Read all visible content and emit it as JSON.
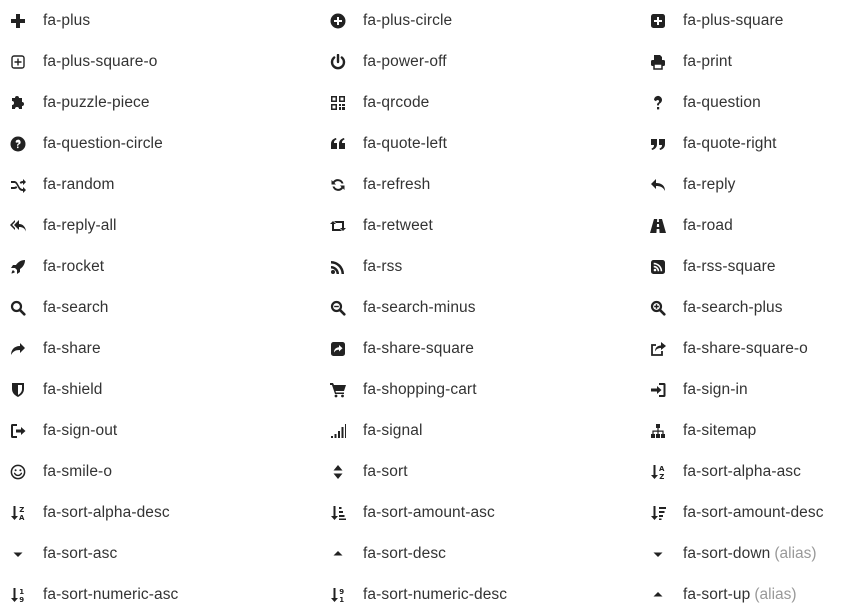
{
  "alias_text": "(alias)",
  "items": [
    {
      "label": "fa-plus",
      "icon": "plus-icon",
      "alias": false
    },
    {
      "label": "fa-plus-circle",
      "icon": "plus-circle-icon",
      "alias": false
    },
    {
      "label": "fa-plus-square",
      "icon": "plus-square-icon",
      "alias": false
    },
    {
      "label": "fa-plus-square-o",
      "icon": "plus-square-o-icon",
      "alias": false
    },
    {
      "label": "fa-power-off",
      "icon": "power-off-icon",
      "alias": false
    },
    {
      "label": "fa-print",
      "icon": "print-icon",
      "alias": false
    },
    {
      "label": "fa-puzzle-piece",
      "icon": "puzzle-piece-icon",
      "alias": false
    },
    {
      "label": "fa-qrcode",
      "icon": "qrcode-icon",
      "alias": false
    },
    {
      "label": "fa-question",
      "icon": "question-icon",
      "alias": false
    },
    {
      "label": "fa-question-circle",
      "icon": "question-circle-icon",
      "alias": false
    },
    {
      "label": "fa-quote-left",
      "icon": "quote-left-icon",
      "alias": false
    },
    {
      "label": "fa-quote-right",
      "icon": "quote-right-icon",
      "alias": false
    },
    {
      "label": "fa-random",
      "icon": "random-icon",
      "alias": false
    },
    {
      "label": "fa-refresh",
      "icon": "refresh-icon",
      "alias": false
    },
    {
      "label": "fa-reply",
      "icon": "reply-icon",
      "alias": false
    },
    {
      "label": "fa-reply-all",
      "icon": "reply-all-icon",
      "alias": false
    },
    {
      "label": "fa-retweet",
      "icon": "retweet-icon",
      "alias": false
    },
    {
      "label": "fa-road",
      "icon": "road-icon",
      "alias": false
    },
    {
      "label": "fa-rocket",
      "icon": "rocket-icon",
      "alias": false
    },
    {
      "label": "fa-rss",
      "icon": "rss-icon",
      "alias": false
    },
    {
      "label": "fa-rss-square",
      "icon": "rss-square-icon",
      "alias": false
    },
    {
      "label": "fa-search",
      "icon": "search-icon",
      "alias": false
    },
    {
      "label": "fa-search-minus",
      "icon": "search-minus-icon",
      "alias": false
    },
    {
      "label": "fa-search-plus",
      "icon": "search-plus-icon",
      "alias": false
    },
    {
      "label": "fa-share",
      "icon": "share-icon",
      "alias": false
    },
    {
      "label": "fa-share-square",
      "icon": "share-square-icon",
      "alias": false
    },
    {
      "label": "fa-share-square-o",
      "icon": "share-square-o-icon",
      "alias": false
    },
    {
      "label": "fa-shield",
      "icon": "shield-icon",
      "alias": false
    },
    {
      "label": "fa-shopping-cart",
      "icon": "shopping-cart-icon",
      "alias": false
    },
    {
      "label": "fa-sign-in",
      "icon": "sign-in-icon",
      "alias": false
    },
    {
      "label": "fa-sign-out",
      "icon": "sign-out-icon",
      "alias": false
    },
    {
      "label": "fa-signal",
      "icon": "signal-icon",
      "alias": false
    },
    {
      "label": "fa-sitemap",
      "icon": "sitemap-icon",
      "alias": false
    },
    {
      "label": "fa-smile-o",
      "icon": "smile-o-icon",
      "alias": false
    },
    {
      "label": "fa-sort",
      "icon": "sort-icon",
      "alias": false
    },
    {
      "label": "fa-sort-alpha-asc",
      "icon": "sort-alpha-asc-icon",
      "alias": false
    },
    {
      "label": "fa-sort-alpha-desc",
      "icon": "sort-alpha-desc-icon",
      "alias": false
    },
    {
      "label": "fa-sort-amount-asc",
      "icon": "sort-amount-asc-icon",
      "alias": false
    },
    {
      "label": "fa-sort-amount-desc",
      "icon": "sort-amount-desc-icon",
      "alias": false
    },
    {
      "label": "fa-sort-asc",
      "icon": "sort-asc-icon",
      "alias": false
    },
    {
      "label": "fa-sort-desc",
      "icon": "sort-desc-icon",
      "alias": false
    },
    {
      "label": "fa-sort-down",
      "icon": "sort-down-icon",
      "alias": true
    },
    {
      "label": "fa-sort-numeric-asc",
      "icon": "sort-numeric-asc-icon",
      "alias": false
    },
    {
      "label": "fa-sort-numeric-desc",
      "icon": "sort-numeric-desc-icon",
      "alias": false
    },
    {
      "label": "fa-sort-up",
      "icon": "sort-up-icon",
      "alias": true
    }
  ]
}
